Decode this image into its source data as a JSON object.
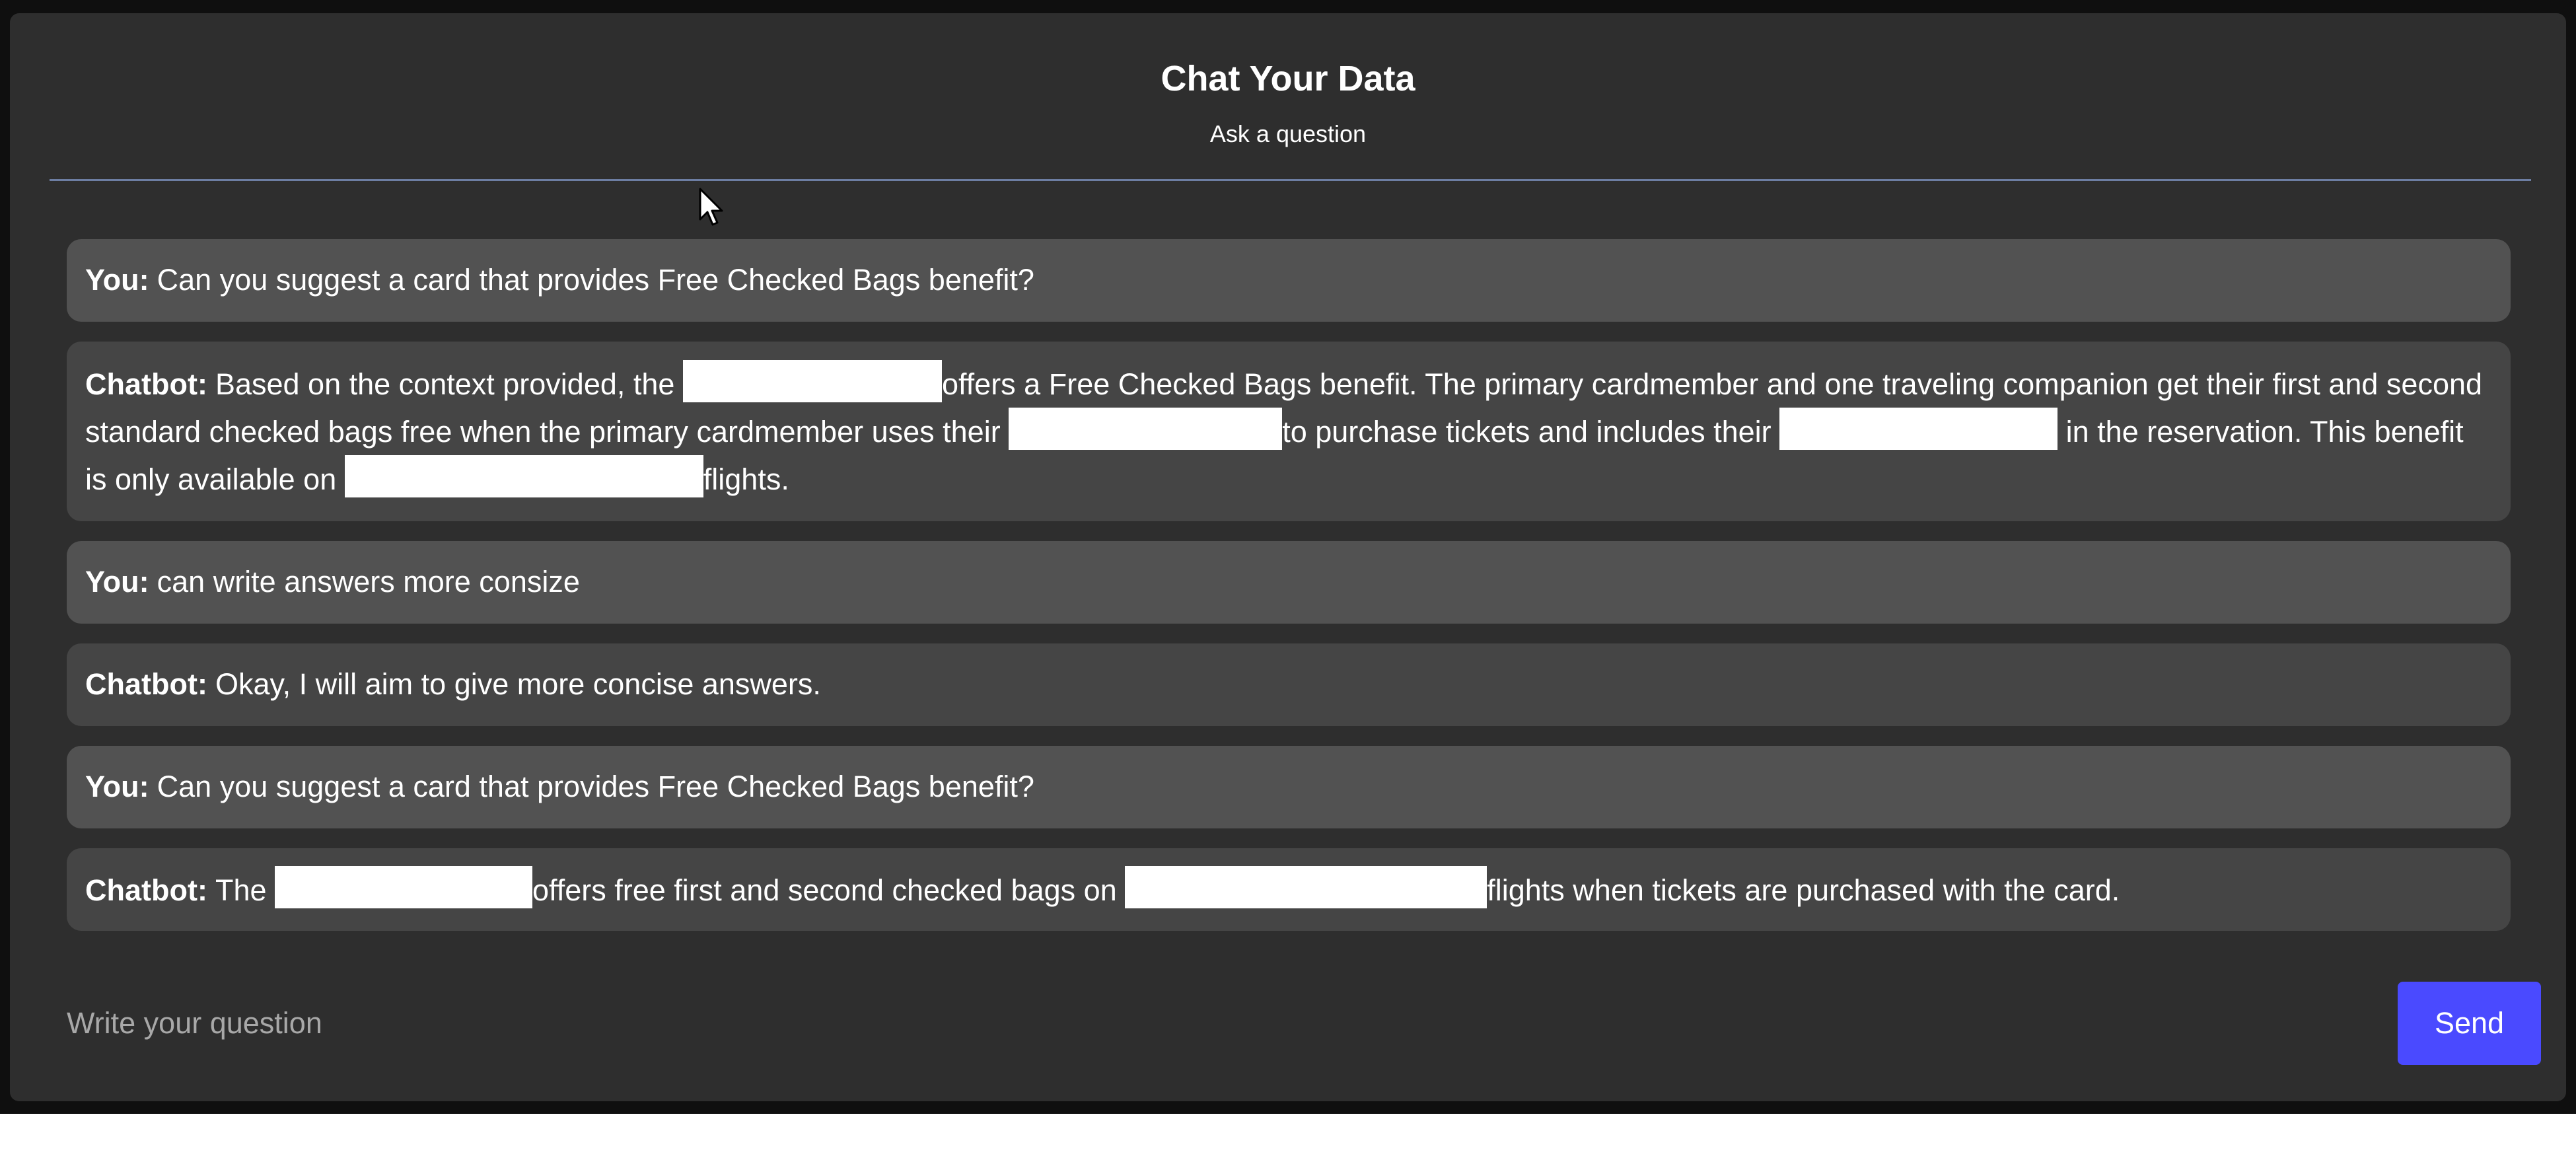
{
  "header": {
    "title": "Chat Your Data",
    "subtitle": "Ask a question"
  },
  "messages": [
    {
      "speaker": "You:",
      "parts": [
        "Can you suggest a card that provides Free Checked Bags benefit?"
      ]
    },
    {
      "speaker": "Chatbot:",
      "parts": [
        "Based on the context provided, the",
        "offers a Free Checked Bags benefit. The primary cardmember and one traveling companion get their first and second standard checked bags free when the primary cardmember uses their",
        "to purchase tickets and includes their",
        "in the reservation. This benefit is only available on",
        "flights."
      ]
    },
    {
      "speaker": "You:",
      "parts": [
        "can write answers more consize"
      ]
    },
    {
      "speaker": "Chatbot:",
      "parts": [
        "Okay, I will aim to give more concise answers."
      ]
    },
    {
      "speaker": "You:",
      "parts": [
        "Can you suggest a card that provides Free Checked Bags benefit?"
      ]
    },
    {
      "speaker": "Chatbot:",
      "parts": [
        "The",
        "offers free first and second checked bags on",
        "flights when tickets are purchased with the card."
      ]
    }
  ],
  "composer": {
    "placeholder": "Write your question",
    "send_label": "Send"
  },
  "icons": {
    "cursor": "mouse-pointer-icon"
  },
  "colors": {
    "send_button": "#4a4aff",
    "user_bubble": "#525252",
    "bot_bubble": "#454545",
    "panel": "#2e2e2e"
  }
}
